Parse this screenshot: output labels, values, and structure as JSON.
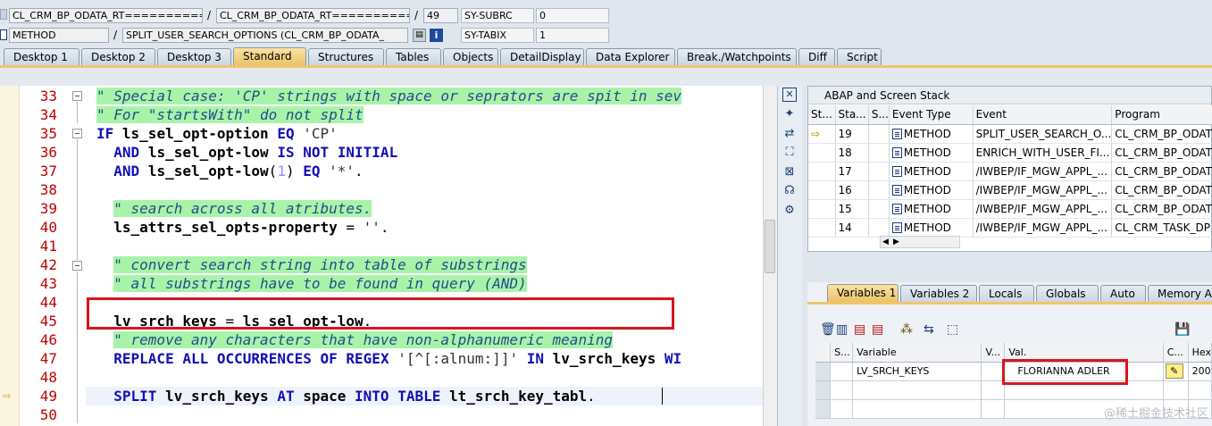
{
  "header": {
    "row1": {
      "program_field": "CL_CRM_BP_ODATA_RT=============",
      "include_field": "CL_CRM_BP_ODATA_RT============",
      "line_field": "49",
      "sysfield_name": "SY-SUBRC",
      "sysfield_value": "0"
    },
    "row2": {
      "event_type_field": "METHOD",
      "event_field": "SPLIT_USER_SEARCH_OPTIONS (CL_CRM_BP_ODATA_",
      "sysfield_name": "SY-TABIX",
      "sysfield_value": "1"
    },
    "separator": "/"
  },
  "debugger_tabs": [
    "Desktop 1",
    "Desktop 2",
    "Desktop 3",
    "Standard",
    "Structures",
    "Tables",
    "Objects",
    "DetailDisplay",
    "Data Explorer",
    "Break./Watchpoints",
    "Diff",
    "Script"
  ],
  "active_debugger_tab": "Standard",
  "source_lines": [
    {
      "no": "33",
      "text": "\" Special case: 'CP' strings with space or seprators are spit in sev"
    },
    {
      "no": "34",
      "text": "\" For \"startsWith\" do not split"
    },
    {
      "no": "35",
      "text": "IF ls_sel_opt-option EQ 'CP'"
    },
    {
      "no": "36",
      "text": "  AND ls_sel_opt-low IS NOT INITIAL"
    },
    {
      "no": "37",
      "text": "  AND ls_sel_opt-low(1) EQ '*'."
    },
    {
      "no": "38",
      "text": ""
    },
    {
      "no": "39",
      "text": "  \" search across all atributes."
    },
    {
      "no": "40",
      "text": "  ls_attrs_sel_opts-property = ''."
    },
    {
      "no": "41",
      "text": ""
    },
    {
      "no": "42",
      "text": "  \" convert search string into table of substrings"
    },
    {
      "no": "43",
      "text": "  \" all substrings have to be found in query (AND)"
    },
    {
      "no": "44",
      "text": ""
    },
    {
      "no": "45",
      "text": "  lv_srch_keys = ls_sel_opt-low."
    },
    {
      "no": "46",
      "text": "  \" remove any characters that have non-alphanumeric meaning"
    },
    {
      "no": "47",
      "text": "  REPLACE ALL OCCURRENCES OF REGEX '[^[:alnum:]]' IN lv_srch_keys WI"
    },
    {
      "no": "48",
      "text": ""
    },
    {
      "no": "49",
      "text": "  SPLIT lv_srch_keys AT space INTO TABLE lt_srch_key_tabl."
    },
    {
      "no": "50",
      "text": ""
    }
  ],
  "current_line": "49",
  "stack": {
    "title": "ABAP and Screen Stack",
    "columns": [
      "St...",
      "Sta...",
      "S...",
      "Event Type",
      "Event",
      "Program"
    ],
    "rows": [
      {
        "level": "19",
        "event_type": "METHOD",
        "event": "SPLIT_USER_SEARCH_O...",
        "program": "CL_CRM_BP_ODAT"
      },
      {
        "level": "18",
        "event_type": "METHOD",
        "event": "ENRICH_WITH_USER_FI...",
        "program": "CL_CRM_BP_ODAT"
      },
      {
        "level": "17",
        "event_type": "METHOD",
        "event": "/IWBEP/IF_MGW_APPL_...",
        "program": "CL_CRM_BP_ODAT"
      },
      {
        "level": "16",
        "event_type": "METHOD",
        "event": "/IWBEP/IF_MGW_APPL_...",
        "program": "CL_CRM_BP_ODAT"
      },
      {
        "level": "15",
        "event_type": "METHOD",
        "event": "/IWBEP/IF_MGW_APPL_...",
        "program": "CL_CRM_BP_ODAT"
      },
      {
        "level": "14",
        "event_type": "METHOD",
        "event": "/IWBEP/IF_MGW_APPL_...",
        "program": "CL_CRM_TASK_DP"
      }
    ]
  },
  "variable_tabs": [
    "Variables 1",
    "Variables 2",
    "Locals",
    "Globals",
    "Auto",
    "Memory Ana"
  ],
  "active_variable_tab": "Variables 1",
  "variables": {
    "columns": [
      "S...",
      "Variable",
      "V...",
      "Val.",
      "C...",
      "Hex"
    ],
    "rows": [
      {
        "name": "LV_SRCH_KEYS",
        "value": "FLORIANNA ADLER",
        "hex": "200"
      }
    ]
  },
  "watermark": "@稀土掘金技术社区",
  "colors": {
    "highlight_red": "#d8161d",
    "comment_bg": "#a9f3a9",
    "keyword": "#1010b8",
    "line_number": "#c00000",
    "active_tab": "#f5d487"
  }
}
